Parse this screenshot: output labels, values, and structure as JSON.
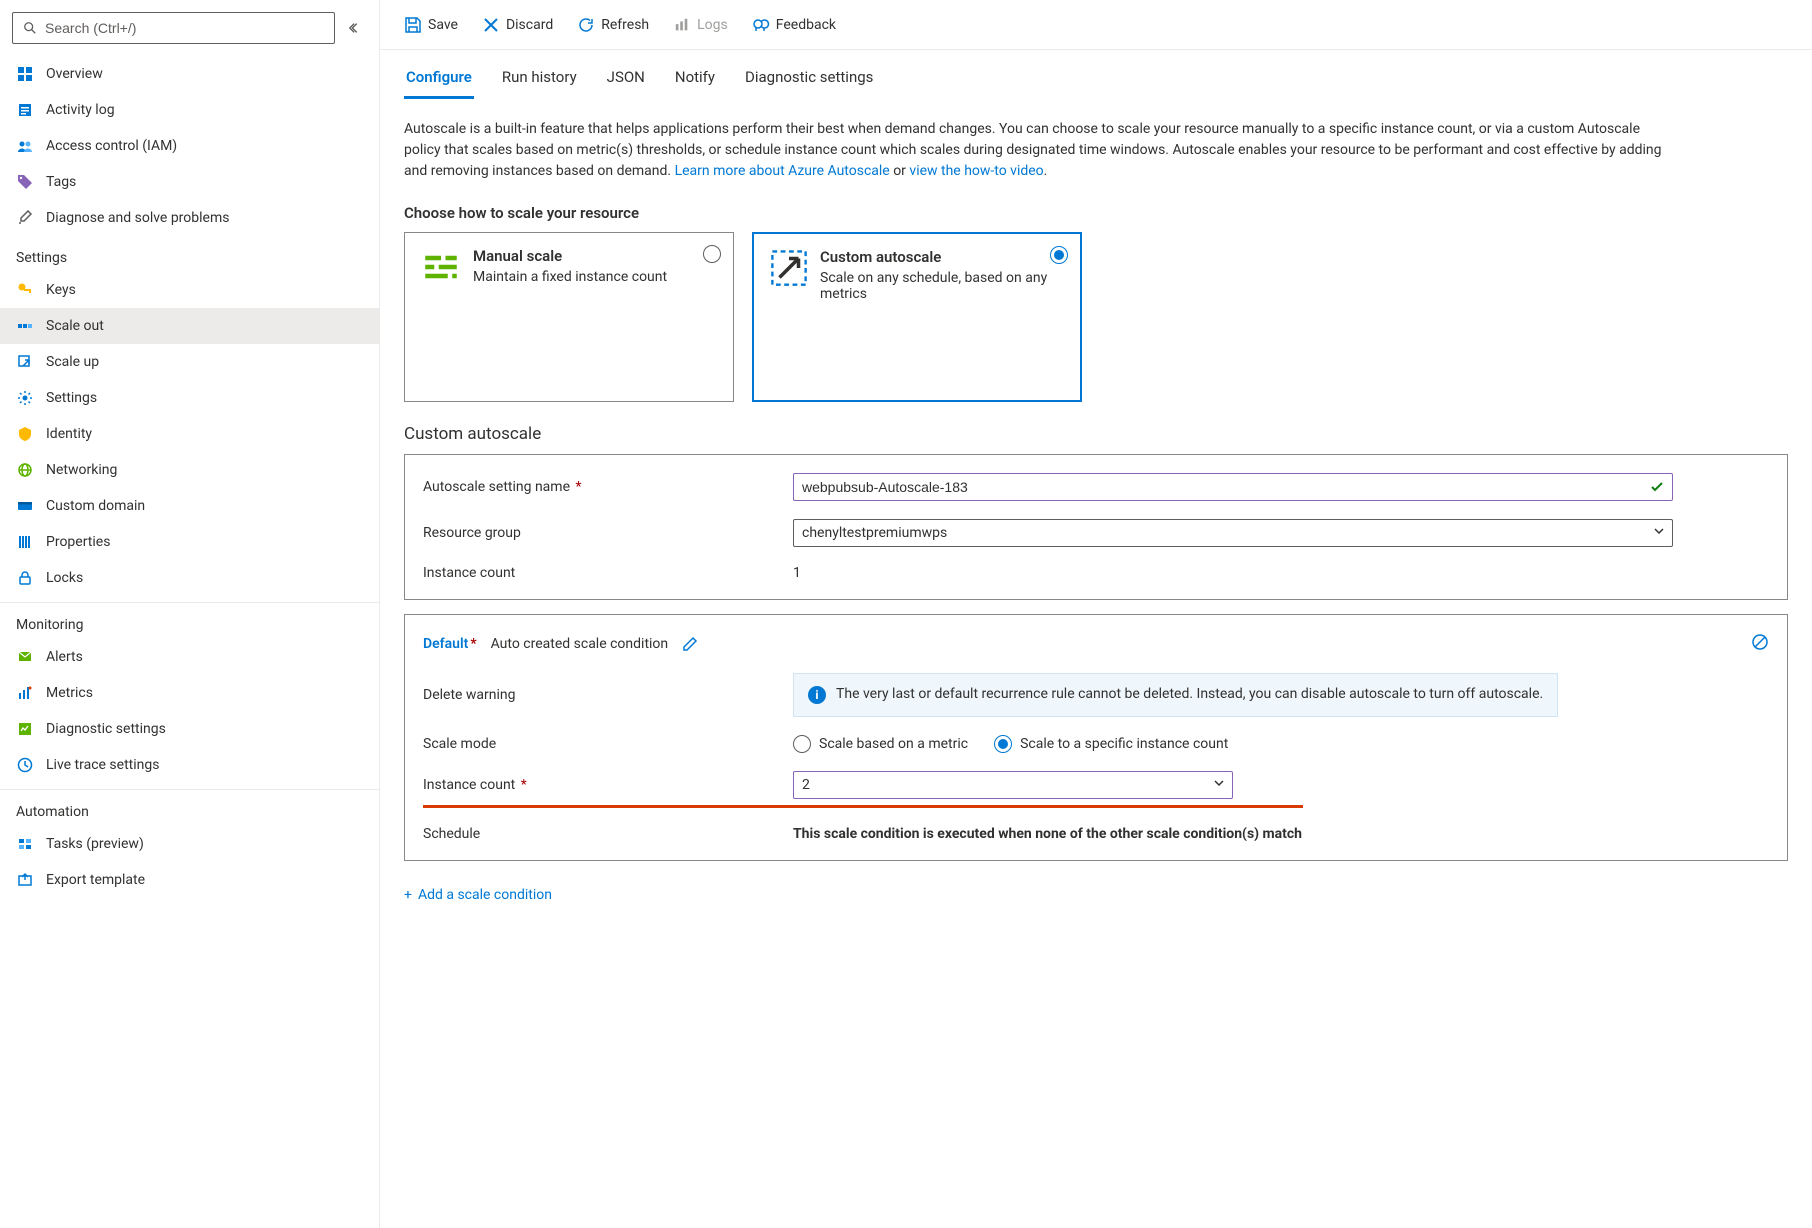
{
  "search": {
    "placeholder": "Search (Ctrl+/)"
  },
  "sidebar": {
    "top": [
      {
        "label": "Overview",
        "icon": "overview"
      },
      {
        "label": "Activity log",
        "icon": "activity-log"
      },
      {
        "label": "Access control (IAM)",
        "icon": "iam"
      },
      {
        "label": "Tags",
        "icon": "tags"
      },
      {
        "label": "Diagnose and solve problems",
        "icon": "diagnose"
      }
    ],
    "sections": [
      {
        "header": "Settings",
        "items": [
          {
            "label": "Keys",
            "icon": "keys"
          },
          {
            "label": "Scale out",
            "icon": "scale-out",
            "selected": true
          },
          {
            "label": "Scale up",
            "icon": "scale-up"
          },
          {
            "label": "Settings",
            "icon": "settings"
          },
          {
            "label": "Identity",
            "icon": "identity"
          },
          {
            "label": "Networking",
            "icon": "networking"
          },
          {
            "label": "Custom domain",
            "icon": "custom-domain"
          },
          {
            "label": "Properties",
            "icon": "properties"
          },
          {
            "label": "Locks",
            "icon": "locks"
          }
        ]
      },
      {
        "header": "Monitoring",
        "items": [
          {
            "label": "Alerts",
            "icon": "alerts"
          },
          {
            "label": "Metrics",
            "icon": "metrics"
          },
          {
            "label": "Diagnostic settings",
            "icon": "diag-settings"
          },
          {
            "label": "Live trace settings",
            "icon": "live-trace"
          }
        ]
      },
      {
        "header": "Automation",
        "items": [
          {
            "label": "Tasks (preview)",
            "icon": "tasks"
          },
          {
            "label": "Export template",
            "icon": "export-template"
          }
        ]
      }
    ]
  },
  "toolbar": {
    "save_label": "Save",
    "discard_label": "Discard",
    "refresh_label": "Refresh",
    "logs_label": "Logs",
    "feedback_label": "Feedback"
  },
  "tabs": [
    {
      "label": "Configure",
      "active": true
    },
    {
      "label": "Run history"
    },
    {
      "label": "JSON"
    },
    {
      "label": "Notify"
    },
    {
      "label": "Diagnostic settings"
    }
  ],
  "intro": {
    "text1": "Autoscale is a built-in feature that helps applications perform their best when demand changes. You can choose to scale your resource manually to a specific instance count, or via a custom Autoscale policy that scales based on metric(s) thresholds, or schedule instance count which scales during designated time windows. Autoscale enables your resource to be performant and cost effective by adding and removing instances based on demand. ",
    "link1": "Learn more about Azure Autoscale",
    "text2": " or ",
    "link2": "view the how-to video",
    "text3": "."
  },
  "choose_title": "Choose how to scale your resource",
  "scale_options": {
    "manual": {
      "title": "Manual scale",
      "desc": "Maintain a fixed instance count"
    },
    "custom": {
      "title": "Custom autoscale",
      "desc": "Scale on any schedule, based on any metrics"
    }
  },
  "custom_section": {
    "title": "Custom autoscale",
    "name_label": "Autoscale setting name",
    "name_value": "webpubsub-Autoscale-183",
    "rg_label": "Resource group",
    "rg_value": "chenyltestpremiumwps",
    "instance_label": "Instance count",
    "instance_value": "1"
  },
  "condition": {
    "title": "Default",
    "subtitle": "Auto created scale condition",
    "delete_label": "Delete warning",
    "delete_info": "The very last or default recurrence rule cannot be deleted. Instead, you can disable autoscale to turn off autoscale.",
    "scale_mode_label": "Scale mode",
    "mode_metric": "Scale based on a metric",
    "mode_count": "Scale to a specific instance count",
    "instance_count_label": "Instance count",
    "instance_count_value": "2",
    "schedule_label": "Schedule",
    "schedule_note": "This scale condition is executed when none of the other scale condition(s) match"
  },
  "add_condition": "Add a scale condition"
}
